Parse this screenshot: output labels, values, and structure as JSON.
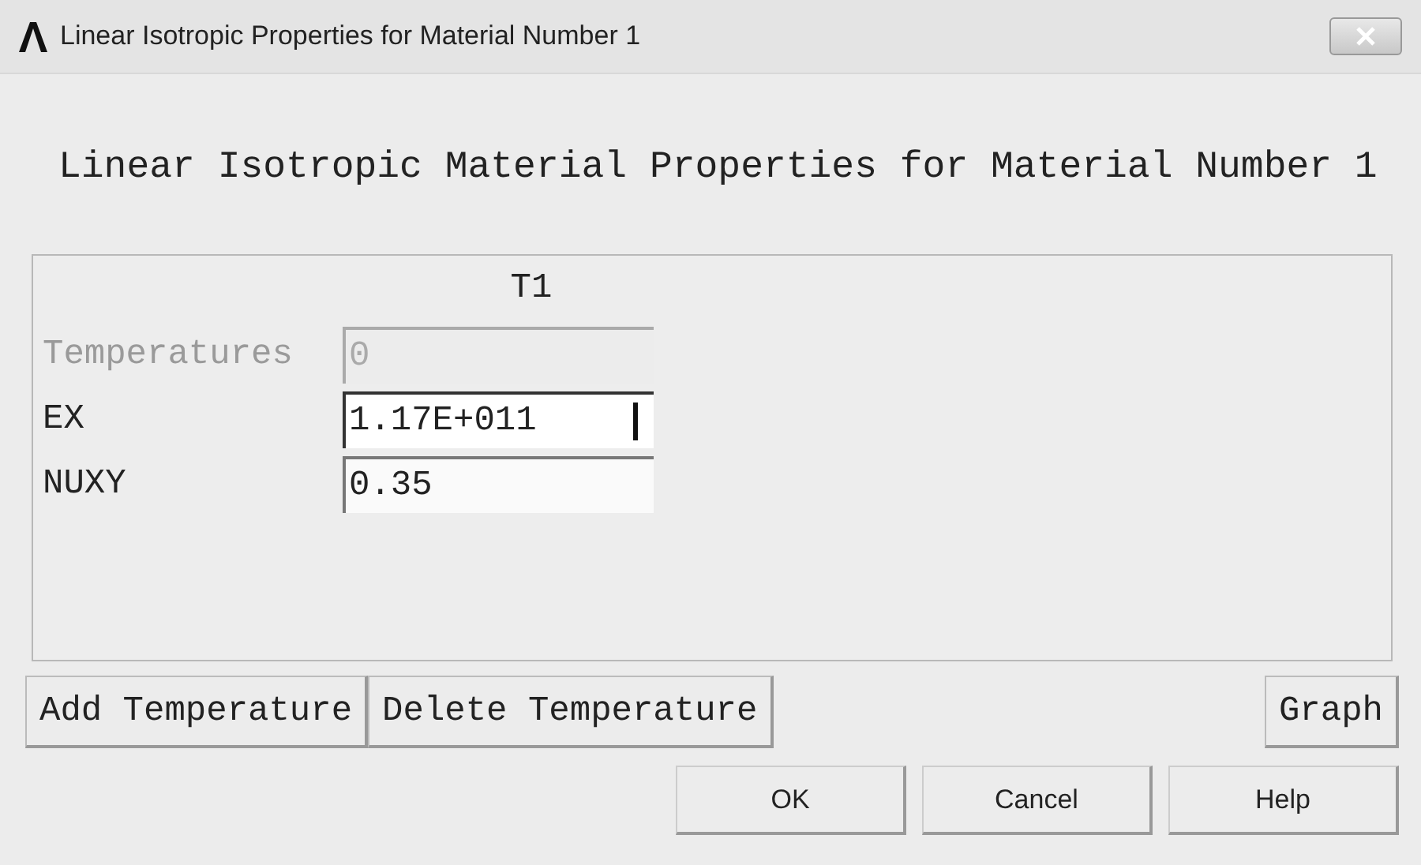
{
  "window": {
    "title": "Linear Isotropic Properties for Material Number 1"
  },
  "heading": "Linear Isotropic Material Properties for Material Number 1",
  "table": {
    "column": "T1",
    "rows": [
      {
        "label": "Temperatures",
        "value": "0",
        "disabled": true,
        "focused": false
      },
      {
        "label": "EX",
        "value": "1.17E+011",
        "disabled": false,
        "focused": true
      },
      {
        "label": "NUXY",
        "value": "0.35",
        "disabled": false,
        "focused": false
      }
    ]
  },
  "table_buttons": [
    "Add Temperature",
    "Delete Temperature"
  ],
  "graph_button": "Graph",
  "buttons": [
    "OK",
    "Cancel",
    "Help"
  ]
}
